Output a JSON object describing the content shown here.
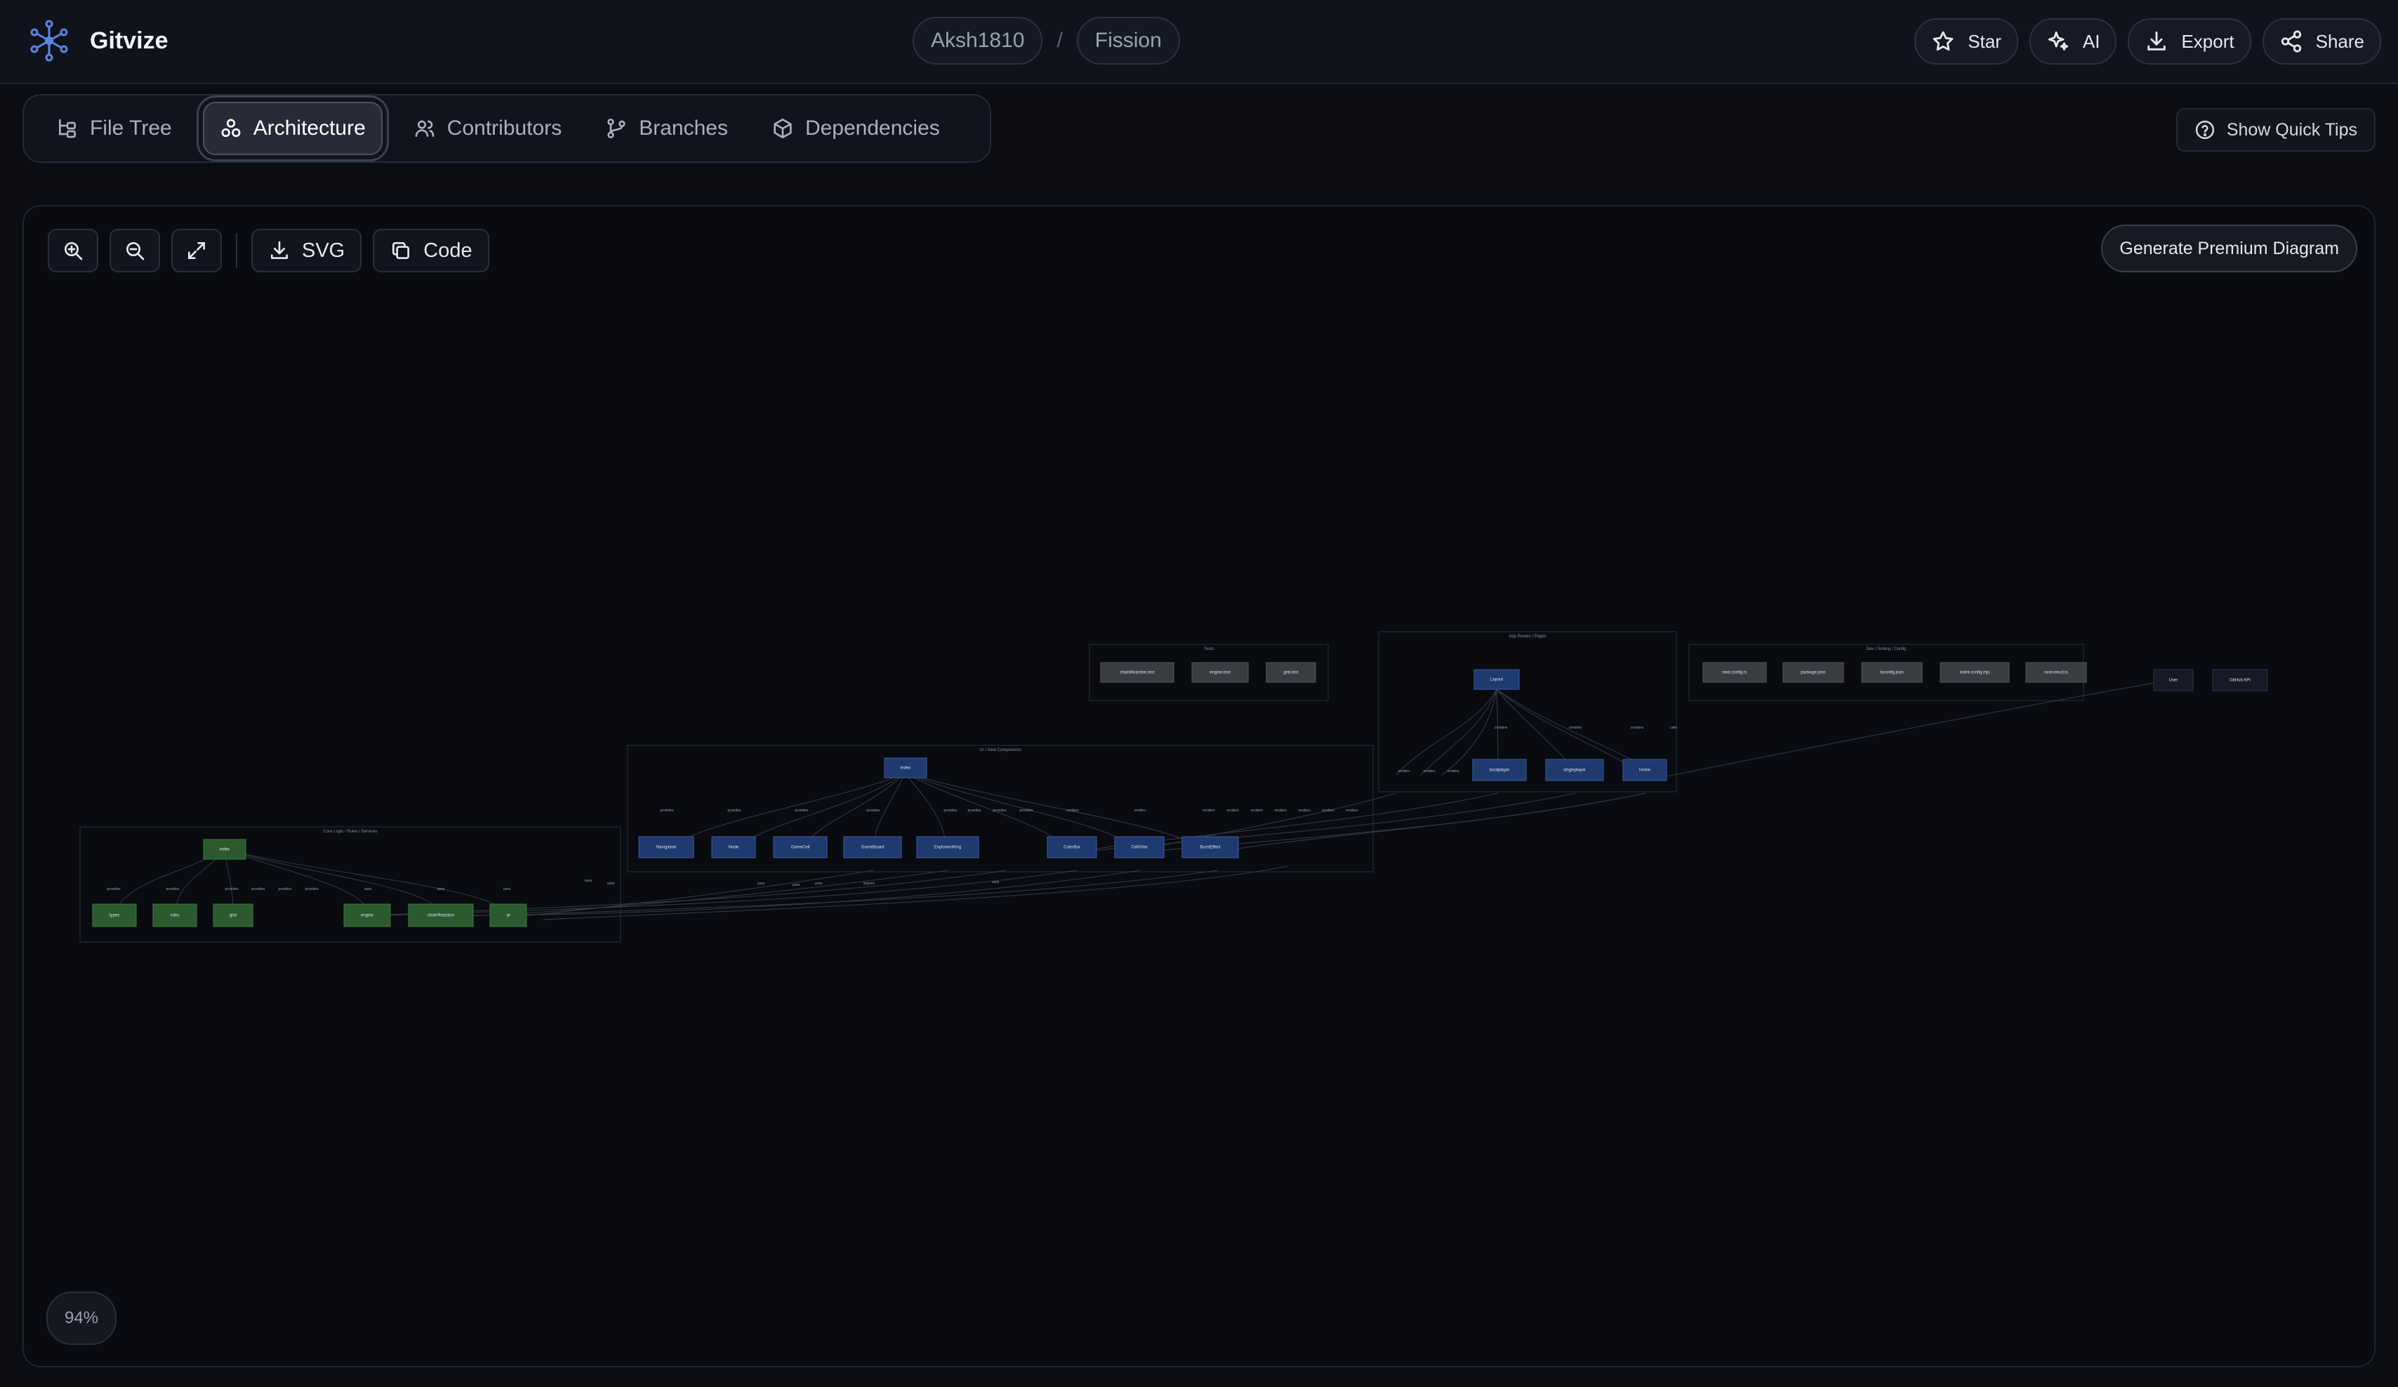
{
  "app": {
    "title": "Gitvize",
    "brand_color": "#5b86e5"
  },
  "breadcrumb": {
    "owner": "Aksh1810",
    "separator": "/",
    "repo": "Fission"
  },
  "header_actions": [
    {
      "label": "Star",
      "icon": "star-icon"
    },
    {
      "label": "AI",
      "icon": "sparkles-icon"
    },
    {
      "label": "Export",
      "icon": "download-icon"
    },
    {
      "label": "Share",
      "icon": "share-icon"
    }
  ],
  "tabs": [
    {
      "label": "File Tree",
      "icon": "file-tree-icon",
      "active": false
    },
    {
      "label": "Architecture",
      "icon": "architecture-icon",
      "active": true
    },
    {
      "label": "Contributors",
      "icon": "users-icon",
      "active": false
    },
    {
      "label": "Branches",
      "icon": "git-branch-icon",
      "active": false
    },
    {
      "label": "Dependencies",
      "icon": "package-icon",
      "active": false
    }
  ],
  "quick_tips": {
    "label": "Show Quick Tips"
  },
  "toolbar": {
    "svg_label": "SVG",
    "code_label": "Code"
  },
  "premium": {
    "label": "Generate Premium Diagram"
  },
  "zoom": {
    "level": "94%"
  },
  "diagram": {
    "groups": {
      "tests": "Tests",
      "app_routes": "App Routes / Pages",
      "dev_config": "Dev / Tooling / Config",
      "ui_components": "UI / View Components",
      "core_logic": "Core Logic / Rules / Services"
    },
    "nodes": {
      "test_chain": "chainReaction.test",
      "test_engine": "engine.test",
      "test_grid": "grid.test",
      "page_layout": "Layout",
      "page_local": "localplayer",
      "page_single": "singleplayer",
      "page_home": "Home",
      "cfg_next": "next.config.ts",
      "cfg_pkg": "package.json",
      "cfg_ts": "tsconfig.json",
      "cfg_eslint": "eslint.config.mjs",
      "cfg_vitest": "next-env.d.ts",
      "ext_user": "User",
      "ext_github": "GitHub API",
      "ui_index": "index",
      "ui_nav": "Navigation",
      "ui_node": "Node",
      "ui_gamecell": "GameCell",
      "ui_gameboard": "GameBoard",
      "ui_explosion": "ExplosionRing",
      "ui_colorbar": "ColorBar",
      "ui_cellorb": "CellOrbs",
      "ui_burst": "BurstEffect",
      "core_index": "index",
      "core_types": "types",
      "core_rules": "rules",
      "core_grid": "grid",
      "core_engine": "engine",
      "core_chain": "chainReaction",
      "core_ai": "ai"
    },
    "edge_labels": {
      "contains": "contains",
      "renders": "renders",
      "provides": "provides",
      "uses": "uses",
      "calls": "calls",
      "imports": "imports"
    }
  }
}
